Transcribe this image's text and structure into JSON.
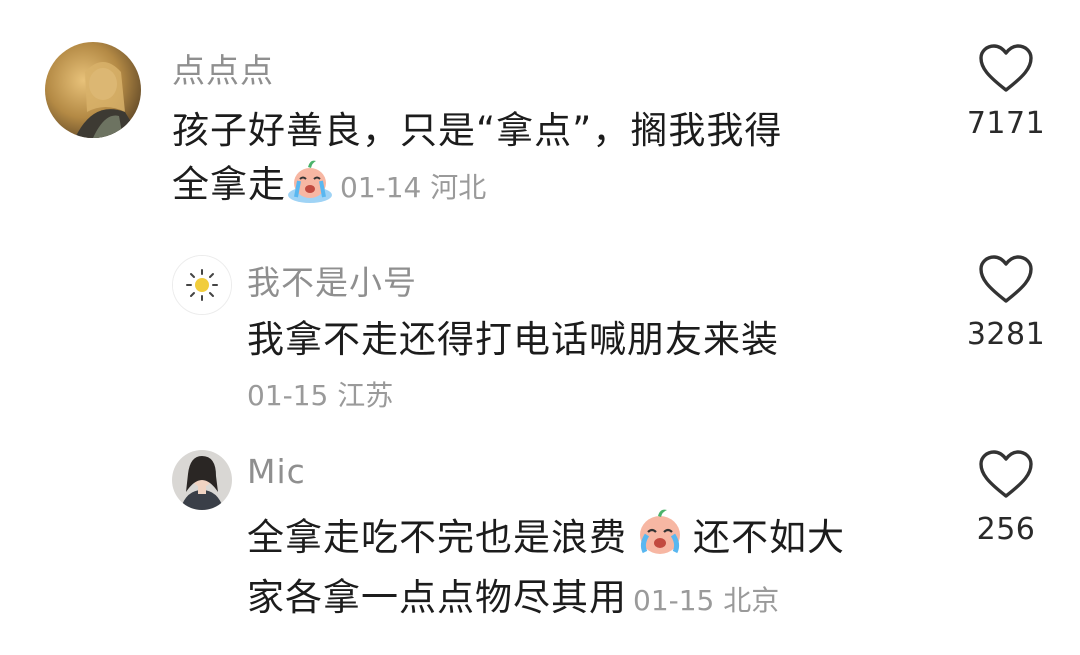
{
  "comments": [
    {
      "username": "点点点",
      "text_line1": "孩子好善良，只是“拿点”，搁我我得",
      "text_line2": "全拿走",
      "emoji": "crying-face-emoji",
      "date": "01-14",
      "location": "河北",
      "likes": "7171"
    },
    {
      "username": "我不是小号",
      "text_line1": "我拿不走还得打电话喊朋友来装",
      "date": "01-15",
      "location": "江苏",
      "likes": "3281"
    },
    {
      "username": "Mic",
      "text_line1": "全拿走吃不完也是浪费",
      "emoji": "crying-face-emoji",
      "text_line1b": "还不如大",
      "text_line2": "家各拿一点点物尽其用",
      "date": "01-15",
      "location": "北京",
      "likes": "256"
    }
  ],
  "colors": {
    "username": "#8f8f8f",
    "text": "#1c1c1c",
    "meta": "#9a9a9a",
    "heart_outline": "#333333"
  },
  "icons": [
    "heart-outline-icon",
    "sun-icon",
    "crying-face-emoji"
  ]
}
